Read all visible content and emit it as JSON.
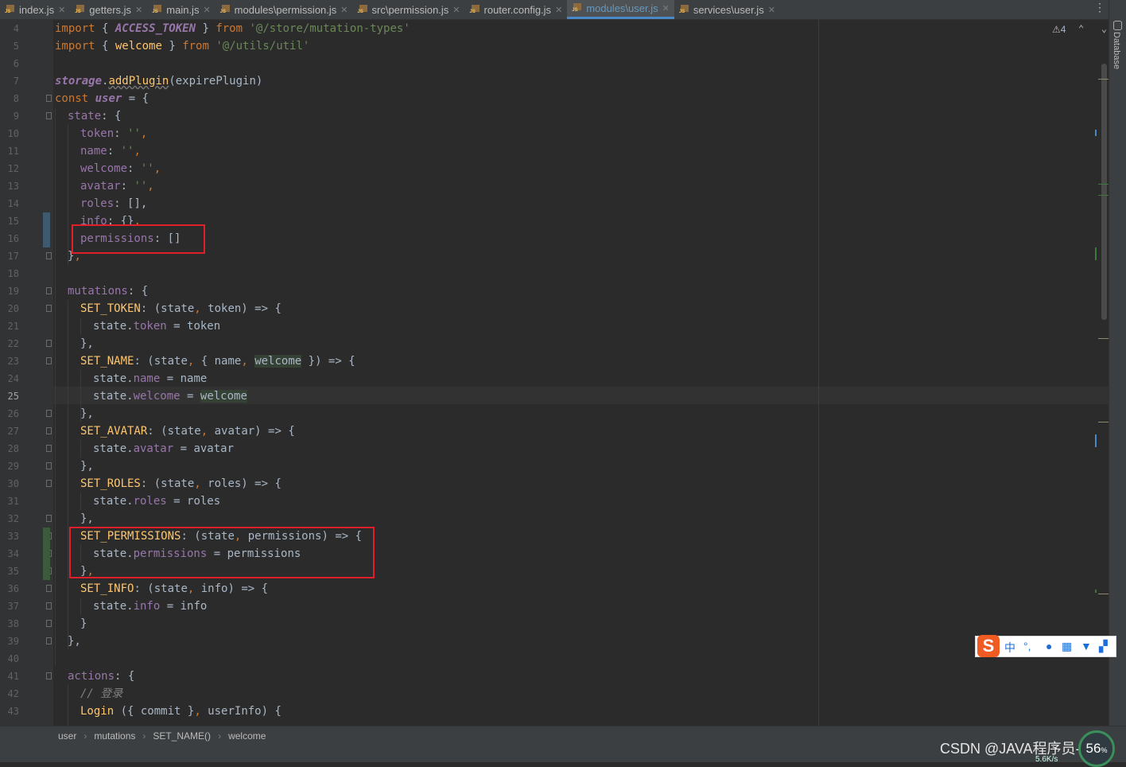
{
  "tabs": [
    {
      "label": "index.js",
      "active": false
    },
    {
      "label": "getters.js",
      "active": false
    },
    {
      "label": "main.js",
      "active": false
    },
    {
      "label": "modules\\permission.js",
      "active": false
    },
    {
      "label": "src\\permission.js",
      "active": false
    },
    {
      "label": "router.config.js",
      "active": false
    },
    {
      "label": "modules\\user.js",
      "active": true
    },
    {
      "label": "services\\user.js",
      "active": false
    }
  ],
  "side_panel": {
    "database_label": "Database"
  },
  "inspections": {
    "warning_count": "4"
  },
  "line_numbers": [
    "4",
    "5",
    "6",
    "7",
    "8",
    "9",
    "10",
    "11",
    "12",
    "13",
    "14",
    "15",
    "16",
    "17",
    "18",
    "19",
    "20",
    "21",
    "22",
    "23",
    "24",
    "25",
    "26",
    "27",
    "28",
    "29",
    "30",
    "31",
    "32",
    "33",
    "34",
    "35",
    "36",
    "37",
    "38",
    "39",
    "40",
    "41",
    "42",
    "43"
  ],
  "current_line": "25",
  "code": {
    "l4": [
      "import",
      " { ",
      "ACCESS_TOKEN",
      " } ",
      "from",
      " ",
      "'@/store/mutation-types'"
    ],
    "l5": [
      "import",
      " { ",
      "welcome",
      " } ",
      "from",
      " ",
      "'@/utils/util'"
    ],
    "l7": [
      "storage",
      ".",
      "addPlugin",
      "(expirePlugin)"
    ],
    "l8": [
      "const",
      " ",
      "user",
      " = {"
    ],
    "l9": [
      "state",
      ": {"
    ],
    "l10": [
      "token",
      ": ",
      "''",
      ","
    ],
    "l11": [
      "name",
      ": ",
      "''",
      ","
    ],
    "l12": [
      "welcome",
      ": ",
      "''",
      ","
    ],
    "l13": [
      "avatar",
      ": ",
      "''",
      ","
    ],
    "l14": [
      "roles",
      ": [],"
    ],
    "l15": [
      "info",
      ": {}",
      ","
    ],
    "l16": [
      "permissions",
      ": []"
    ],
    "l17": [
      "}",
      ","
    ],
    "l19": [
      "mutations",
      ": {"
    ],
    "l20": [
      "SET_TOKEN",
      ": (state",
      ",",
      " token) => {"
    ],
    "l21": [
      "state.",
      "token",
      " = token"
    ],
    "l22": [
      "},"
    ],
    "l23": [
      "SET_NAME",
      ": (state",
      ",",
      " { name",
      ",",
      " ",
      "welcome",
      " }) => {"
    ],
    "l24": [
      "state.",
      "name",
      " = name"
    ],
    "l25": [
      "state.",
      "welcome",
      " = ",
      "welcome"
    ],
    "l26": [
      "},"
    ],
    "l27": [
      "SET_AVATAR",
      ": (state",
      ",",
      " avatar) => {"
    ],
    "l28": [
      "state.",
      "avatar",
      " = avatar"
    ],
    "l29": [
      "},"
    ],
    "l30": [
      "SET_ROLES",
      ": (state",
      ",",
      " roles) => {"
    ],
    "l31": [
      "state.",
      "roles",
      " = roles"
    ],
    "l32": [
      "},"
    ],
    "l33": [
      "SET_PERMISSIONS",
      ": (state",
      ",",
      " permissions) => {"
    ],
    "l34": [
      "state.",
      "permissions",
      " = permissions"
    ],
    "l35": [
      "}",
      ","
    ],
    "l36": [
      "SET_INFO",
      ": (state",
      ",",
      " info) => {"
    ],
    "l37": [
      "state.",
      "info",
      " = info"
    ],
    "l38": [
      "}"
    ],
    "l39": [
      "},"
    ],
    "l41": [
      "actions",
      ": {"
    ],
    "l42": [
      "// 登录"
    ],
    "l43": [
      "Login",
      " ({ commit }",
      ",",
      " userInfo) {"
    ]
  },
  "breadcrumb": [
    "user",
    "mutations",
    "SET_NAME()",
    "welcome"
  ],
  "watermark": "CSDN @JAVA程序员-张三",
  "net_monitor": {
    "percent": "56",
    "percent_unit": "%",
    "speed": "5.6K/s"
  },
  "ime_toolbar": {
    "logo": "S",
    "mode": "中",
    "punct": "°,"
  },
  "colors": {
    "keyword": "#cc7832",
    "string": "#6a8759",
    "property": "#9876aa",
    "function": "#ffc66d",
    "highlight_box": "#e01f2a"
  }
}
